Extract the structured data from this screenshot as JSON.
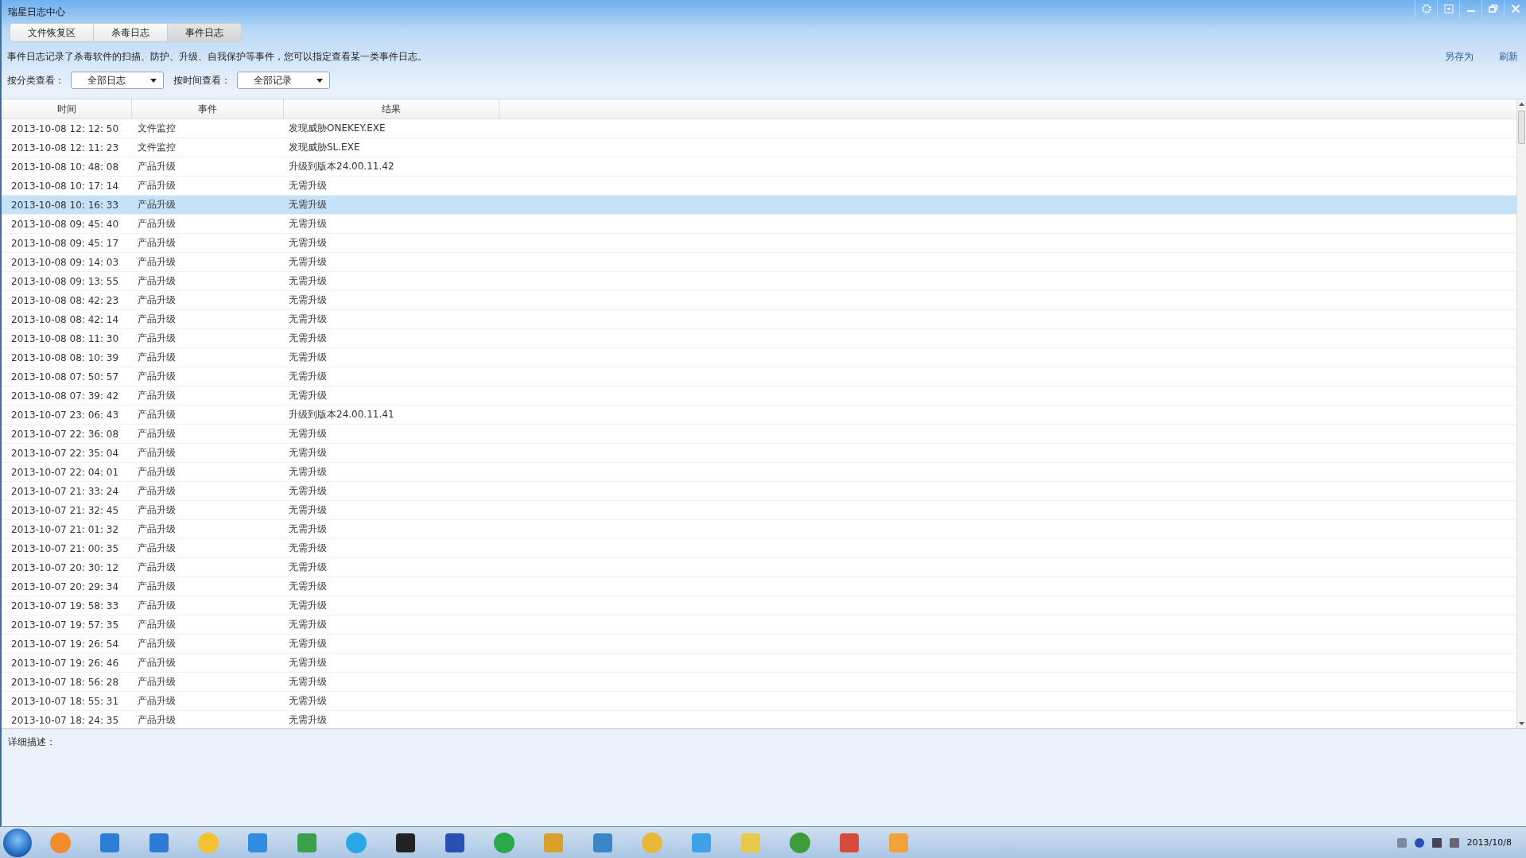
{
  "window": {
    "title": "瑞星日志中心"
  },
  "tabs": [
    {
      "label": "文件恢复区",
      "selected": false
    },
    {
      "label": "杀毒日志",
      "selected": false
    },
    {
      "label": "事件日志",
      "selected": true
    }
  ],
  "description": "事件日志记录了杀毒软件的扫描、防护、升级、自我保护等事件，您可以指定查看某一类事件日志。",
  "actions": [
    "另存为",
    "刷新"
  ],
  "filters": [
    {
      "label": "按分类查看：",
      "value": "全部日志"
    },
    {
      "label": "按时间查看：",
      "value": "全部记录"
    }
  ],
  "table": {
    "columns": [
      "时间",
      "事件",
      "结果"
    ],
    "rows": [
      {
        "time": "2013-10-08 12: 12: 50",
        "event": "文件监控",
        "result": "发现威胁ONEKEY.EXE",
        "selected": false
      },
      {
        "time": "2013-10-08 12: 11: 23",
        "event": "文件监控",
        "result": "发现威胁SL.EXE",
        "selected": false
      },
      {
        "time": "2013-10-08 10: 48: 08",
        "event": "产品升级",
        "result": "升级到版本24.00.11.42",
        "selected": false
      },
      {
        "time": "2013-10-08 10: 17: 14",
        "event": "产品升级",
        "result": "无需升级",
        "selected": false
      },
      {
        "time": "2013-10-08 10: 16: 33",
        "event": "产品升级",
        "result": "无需升级",
        "selected": true
      },
      {
        "time": "2013-10-08 09: 45: 40",
        "event": "产品升级",
        "result": "无需升级",
        "selected": false
      },
      {
        "time": "2013-10-08 09: 45: 17",
        "event": "产品升级",
        "result": "无需升级",
        "selected": false
      },
      {
        "time": "2013-10-08 09: 14: 03",
        "event": "产品升级",
        "result": "无需升级",
        "selected": false
      },
      {
        "time": "2013-10-08 09: 13: 55",
        "event": "产品升级",
        "result": "无需升级",
        "selected": false
      },
      {
        "time": "2013-10-08 08: 42: 23",
        "event": "产品升级",
        "result": "无需升级",
        "selected": false
      },
      {
        "time": "2013-10-08 08: 42: 14",
        "event": "产品升级",
        "result": "无需升级",
        "selected": false
      },
      {
        "time": "2013-10-08 08: 11: 30",
        "event": "产品升级",
        "result": "无需升级",
        "selected": false
      },
      {
        "time": "2013-10-08 08: 10: 39",
        "event": "产品升级",
        "result": "无需升级",
        "selected": false
      },
      {
        "time": "2013-10-08 07: 50: 57",
        "event": "产品升级",
        "result": "无需升级",
        "selected": false
      },
      {
        "time": "2013-10-08 07: 39: 42",
        "event": "产品升级",
        "result": "无需升级",
        "selected": false
      },
      {
        "time": "2013-10-07 23: 06: 43",
        "event": "产品升级",
        "result": "升级到版本24.00.11.41",
        "selected": false
      },
      {
        "time": "2013-10-07 22: 36: 08",
        "event": "产品升级",
        "result": "无需升级",
        "selected": false
      },
      {
        "time": "2013-10-07 22: 35: 04",
        "event": "产品升级",
        "result": "无需升级",
        "selected": false
      },
      {
        "time": "2013-10-07 22: 04: 01",
        "event": "产品升级",
        "result": "无需升级",
        "selected": false
      },
      {
        "time": "2013-10-07 21: 33: 24",
        "event": "产品升级",
        "result": "无需升级",
        "selected": false
      },
      {
        "time": "2013-10-07 21: 32: 45",
        "event": "产品升级",
        "result": "无需升级",
        "selected": false
      },
      {
        "time": "2013-10-07 21: 01: 32",
        "event": "产品升级",
        "result": "无需升级",
        "selected": false
      },
      {
        "time": "2013-10-07 21: 00: 35",
        "event": "产品升级",
        "result": "无需升级",
        "selected": false
      },
      {
        "time": "2013-10-07 20: 30: 12",
        "event": "产品升级",
        "result": "无需升级",
        "selected": false
      },
      {
        "time": "2013-10-07 20: 29: 34",
        "event": "产品升级",
        "result": "无需升级",
        "selected": false
      },
      {
        "time": "2013-10-07 19: 58: 33",
        "event": "产品升级",
        "result": "无需升级",
        "selected": false
      },
      {
        "time": "2013-10-07 19: 57: 35",
        "event": "产品升级",
        "result": "无需升级",
        "selected": false
      },
      {
        "time": "2013-10-07 19: 26: 54",
        "event": "产品升级",
        "result": "无需升级",
        "selected": false
      },
      {
        "time": "2013-10-07 19: 26: 46",
        "event": "产品升级",
        "result": "无需升级",
        "selected": false
      },
      {
        "time": "2013-10-07 18: 56: 28",
        "event": "产品升级",
        "result": "无需升级",
        "selected": false
      },
      {
        "time": "2013-10-07 18: 55: 31",
        "event": "产品升级",
        "result": "无需升级",
        "selected": false
      },
      {
        "time": "2013-10-07 18: 24: 35",
        "event": "产品升级",
        "result": "无需升级",
        "selected": false
      }
    ]
  },
  "details": {
    "label": "详细描述："
  },
  "taskbar": {
    "date": "2013/10/8"
  }
}
